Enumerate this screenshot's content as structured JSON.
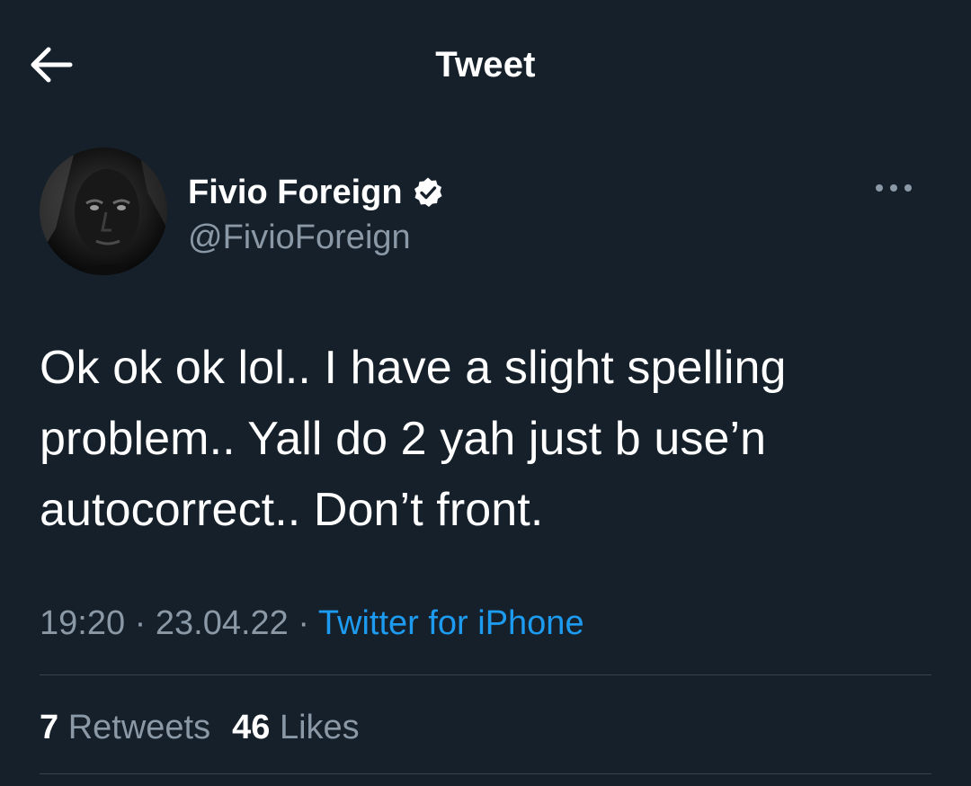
{
  "header": {
    "title": "Tweet",
    "back_icon": "arrow-left-icon"
  },
  "author": {
    "display_name": "Fivio Foreign",
    "handle": "@FivioForeign",
    "verified": true,
    "verified_icon": "verified-badge-icon",
    "more_icon": "more-horizontal-icon"
  },
  "tweet": {
    "text": "Ok ok ok lol.. I have a slight spelling problem.. Yall do 2 yah just b use’n autocorrect.. Don’t front."
  },
  "meta": {
    "time": "19:20",
    "separator": "·",
    "date": "23.04.22",
    "source": "Twitter for iPhone"
  },
  "stats": {
    "retweets_count": "7",
    "retweets_label": "Retweets",
    "likes_count": "46",
    "likes_label": "Likes"
  },
  "colors": {
    "background": "#15202b",
    "text_primary": "#ffffff",
    "text_secondary": "#8b98a5",
    "accent": "#1d9bf0",
    "divider": "#38444d"
  }
}
